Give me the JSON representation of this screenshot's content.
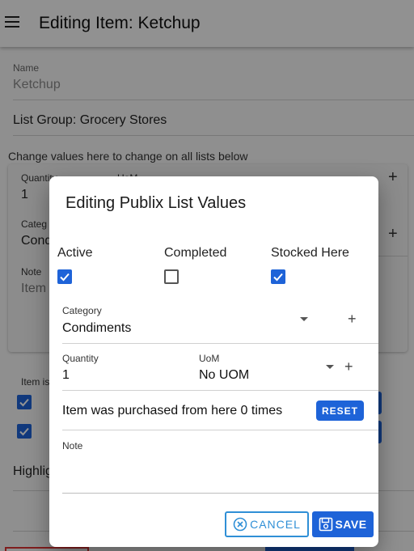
{
  "appbar": {
    "title": "Editing Item: Ketchup"
  },
  "background": {
    "name_label": "Name",
    "name_value": "Ketchup",
    "list_group": "List Group: Grocery Stores",
    "change_hint": "Change values here to change on all lists below",
    "quantity_label": "Quantity",
    "quantity_value": "1",
    "uom_label": "UoM",
    "category_label_partial": "Categ",
    "category_value_partial": "Cond",
    "note_label": "Note",
    "note_value_partial": "Item",
    "item_is_partial": "Item is",
    "highlight_partial": "Highlig"
  },
  "dialog": {
    "title": "Editing Publix List Values",
    "flags": [
      {
        "label": "Active",
        "checked": true
      },
      {
        "label": "Completed",
        "checked": false
      },
      {
        "label": "Stocked Here",
        "checked": true
      }
    ],
    "category": {
      "label": "Category",
      "value": "Condiments"
    },
    "quantity": {
      "label": "Quantity",
      "value": "1"
    },
    "uom": {
      "label": "UoM",
      "value": "No UOM"
    },
    "purchased_text": "Item was purchased from here 0 times",
    "reset_label": "RESET",
    "note_label": "Note",
    "cancel_label": "CANCEL",
    "save_label": "SAVE"
  },
  "colors": {
    "primary": "#1e63d8",
    "cancel_outline": "#2f8fd6",
    "scrim": "rgba(0,0,0,0.42)"
  },
  "icons": {
    "menu": "menu-icon",
    "plus": "plus-icon",
    "caret": "chevron-down-icon",
    "cancel": "cancel-circle-icon",
    "save": "save-icon",
    "check": "check-icon"
  }
}
